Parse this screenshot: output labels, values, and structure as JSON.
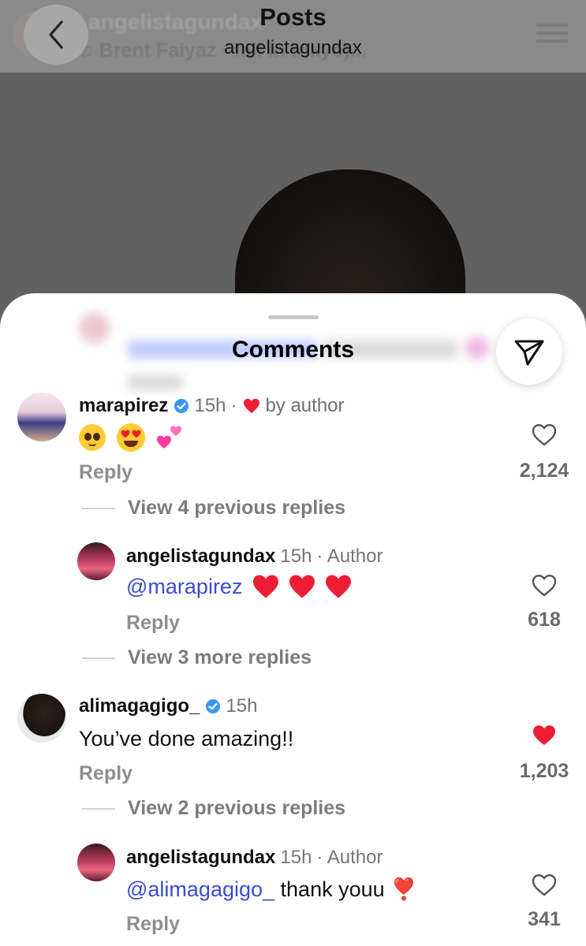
{
  "header": {
    "title": "Posts",
    "subtitle": "angelistagundax",
    "ghost_username": "angelistagundax",
    "ghost_song": "♫ Brent Faiyaz · fall in tokyo)..."
  },
  "sheet": {
    "title": "Comments"
  },
  "comments": [
    {
      "username": "marapirez",
      "verified": true,
      "time": "15h",
      "separator": "·",
      "liked_by_author_text": "by author",
      "text": "",
      "emojis": [
        "pleading-face",
        "heart-eyes-face",
        "two-hearts"
      ],
      "reply_label": "Reply",
      "like_count": "2,124",
      "liked": false
    },
    {
      "username": "angelistagundax",
      "time": "15h",
      "author_tag": "· Author",
      "mention": "@marapirez",
      "text": "",
      "emojis": [
        "red-heart",
        "red-heart",
        "red-heart"
      ],
      "reply_label": "Reply",
      "like_count": "618",
      "liked": false
    },
    {
      "username": "alimagagigo_",
      "verified": true,
      "time": "15h",
      "text": "You’ve done amazing!!",
      "reply_label": "Reply",
      "like_count": "1,203",
      "liked": true
    },
    {
      "username": "angelistagundax",
      "time": "15h",
      "author_tag": "· Author",
      "mention": "@alimagagigo_",
      "text": " thank youu ❣️",
      "reply_label": "Reply",
      "like_count": "341",
      "liked": false
    }
  ],
  "thread_links": [
    {
      "label": "View 4 previous replies"
    },
    {
      "label": "View 3 more replies"
    },
    {
      "label": "View 2 previous replies"
    }
  ],
  "colors": {
    "mention": "#3c4cd0",
    "like_red": "#ee1d36",
    "verified_blue": "#3897f0"
  }
}
